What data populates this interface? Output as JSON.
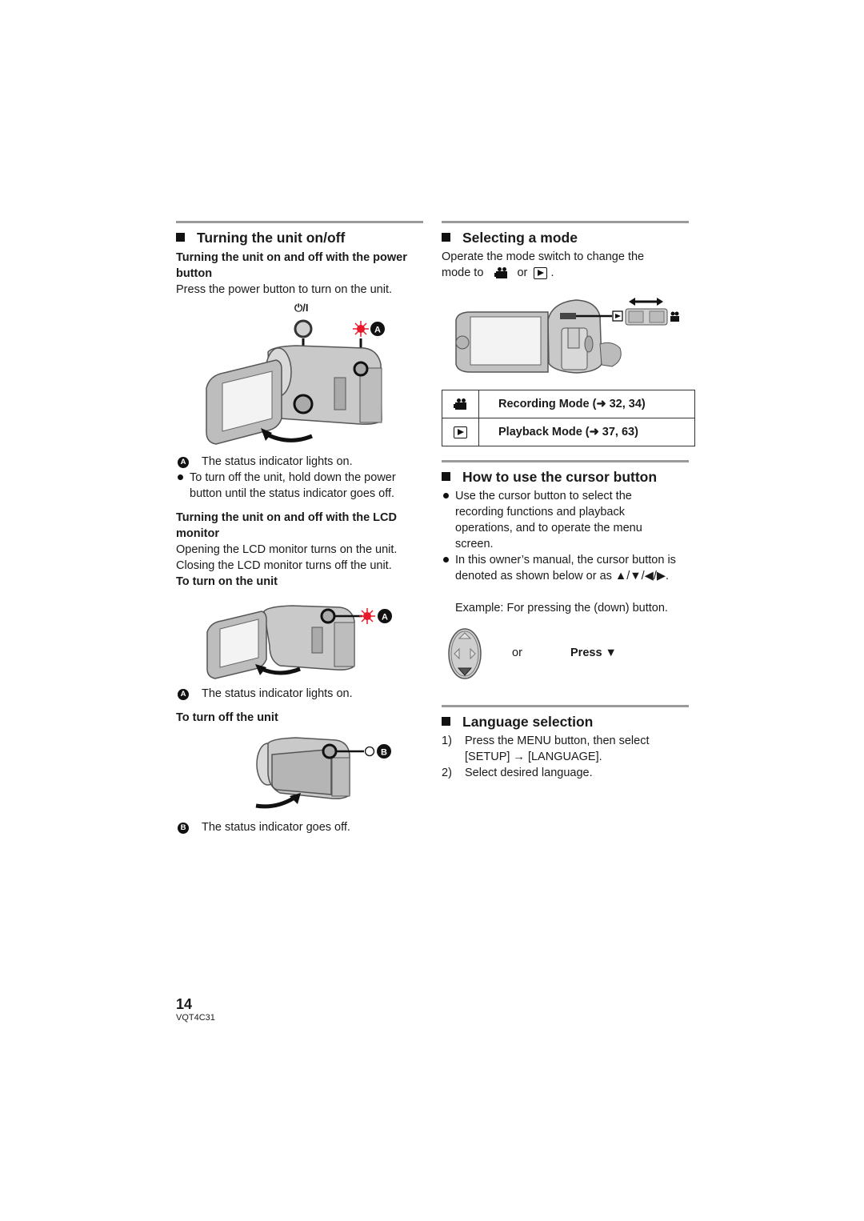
{
  "left_column": {
    "section_title": "Turning the unit on/off",
    "sub1_title": "Turning the unit on and off with the power button",
    "sub1_text": "Press the power button to turn on the unit.",
    "power_label": "⏻/I",
    "marker_a": "A",
    "marker_b": "B",
    "legend_a_1": "The status indicator lights on.",
    "bullet_1": "To turn off the unit, hold down the power button until the status indicator goes off.",
    "sub2_title": "Turning the unit on and off with the LCD monitor",
    "sub2_text_1": "Opening the LCD monitor turns on the unit.",
    "sub2_text_2": "Closing the LCD monitor turns off the unit.",
    "turn_on_title": "To turn on the unit",
    "legend_a_2": "The status indicator lights on.",
    "turn_off_title": "To turn off the unit",
    "legend_b": "The status indicator goes off."
  },
  "right_column": {
    "mode_title": "Selecting a mode",
    "mode_text_1": "Operate the mode switch to change the",
    "mode_text_2a": "mode to",
    "mode_text_2b": "or",
    "mode_text_2c": ".",
    "mode_table": [
      {
        "icon": "movie-camera-icon",
        "label": "Recording Mode (➜ 32, 34)"
      },
      {
        "icon": "playback-icon",
        "label": "Playback Mode (➜ 37, 63)"
      }
    ],
    "cursor_title": "How to use the cursor button",
    "cursor_bullet_1": "Use the cursor button to select the recording functions and playback operations, and to operate the menu screen.",
    "cursor_bullet_2": "In this owner’s manual, the cursor button is denoted as shown below or as ▲/▼/◀/▶.",
    "cursor_example": "Example: For pressing the (down) button.",
    "or_label": "or",
    "press_label": "Press ▼",
    "language_title": "Language selection",
    "language_steps": [
      {
        "num": "1)",
        "text": "Press the MENU button, then select [SETUP] → [LANGUAGE]."
      },
      {
        "num": "2)",
        "text": "Select desired language."
      }
    ]
  },
  "footer": {
    "page_number": "14",
    "doc_code": "VQT4C31"
  },
  "colors": {
    "indicator_on": "#e8182a",
    "rule": "#9a9a9a",
    "camera_body": "#c9c9c9"
  }
}
